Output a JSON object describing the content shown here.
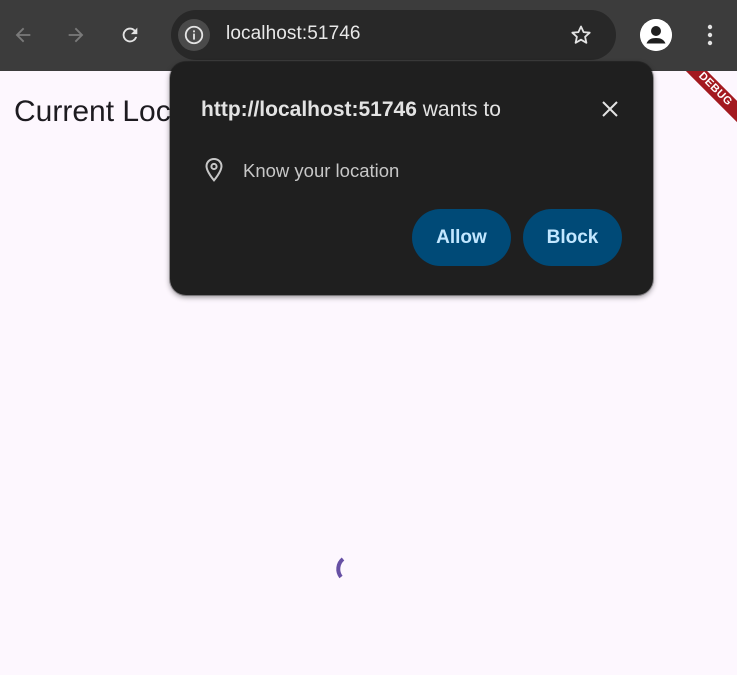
{
  "browser": {
    "url": "localhost:51746",
    "colors": {
      "toolbar": "#3c3c3c",
      "omnibox": "#282828"
    }
  },
  "page": {
    "title": "Current Location",
    "debug_banner": "DEBUG",
    "spinner_color": "#6750a4",
    "background": "#fdf7fe"
  },
  "permission_prompt": {
    "origin": "http://localhost:51746",
    "title_suffix": " wants to",
    "permission_label": "Know your location",
    "allow_label": "Allow",
    "block_label": "Block",
    "colors": {
      "background": "#1f1f1f",
      "button": "#004a77",
      "button_text": "#c2e7ff"
    }
  },
  "icons": {
    "back": "arrow-left-icon",
    "forward": "arrow-right-icon",
    "reload": "reload-icon",
    "site_info": "info-icon",
    "bookmark": "star-icon",
    "profile": "person-icon",
    "menu": "kebab-menu-icon",
    "close": "close-icon",
    "location": "location-pin-icon"
  }
}
